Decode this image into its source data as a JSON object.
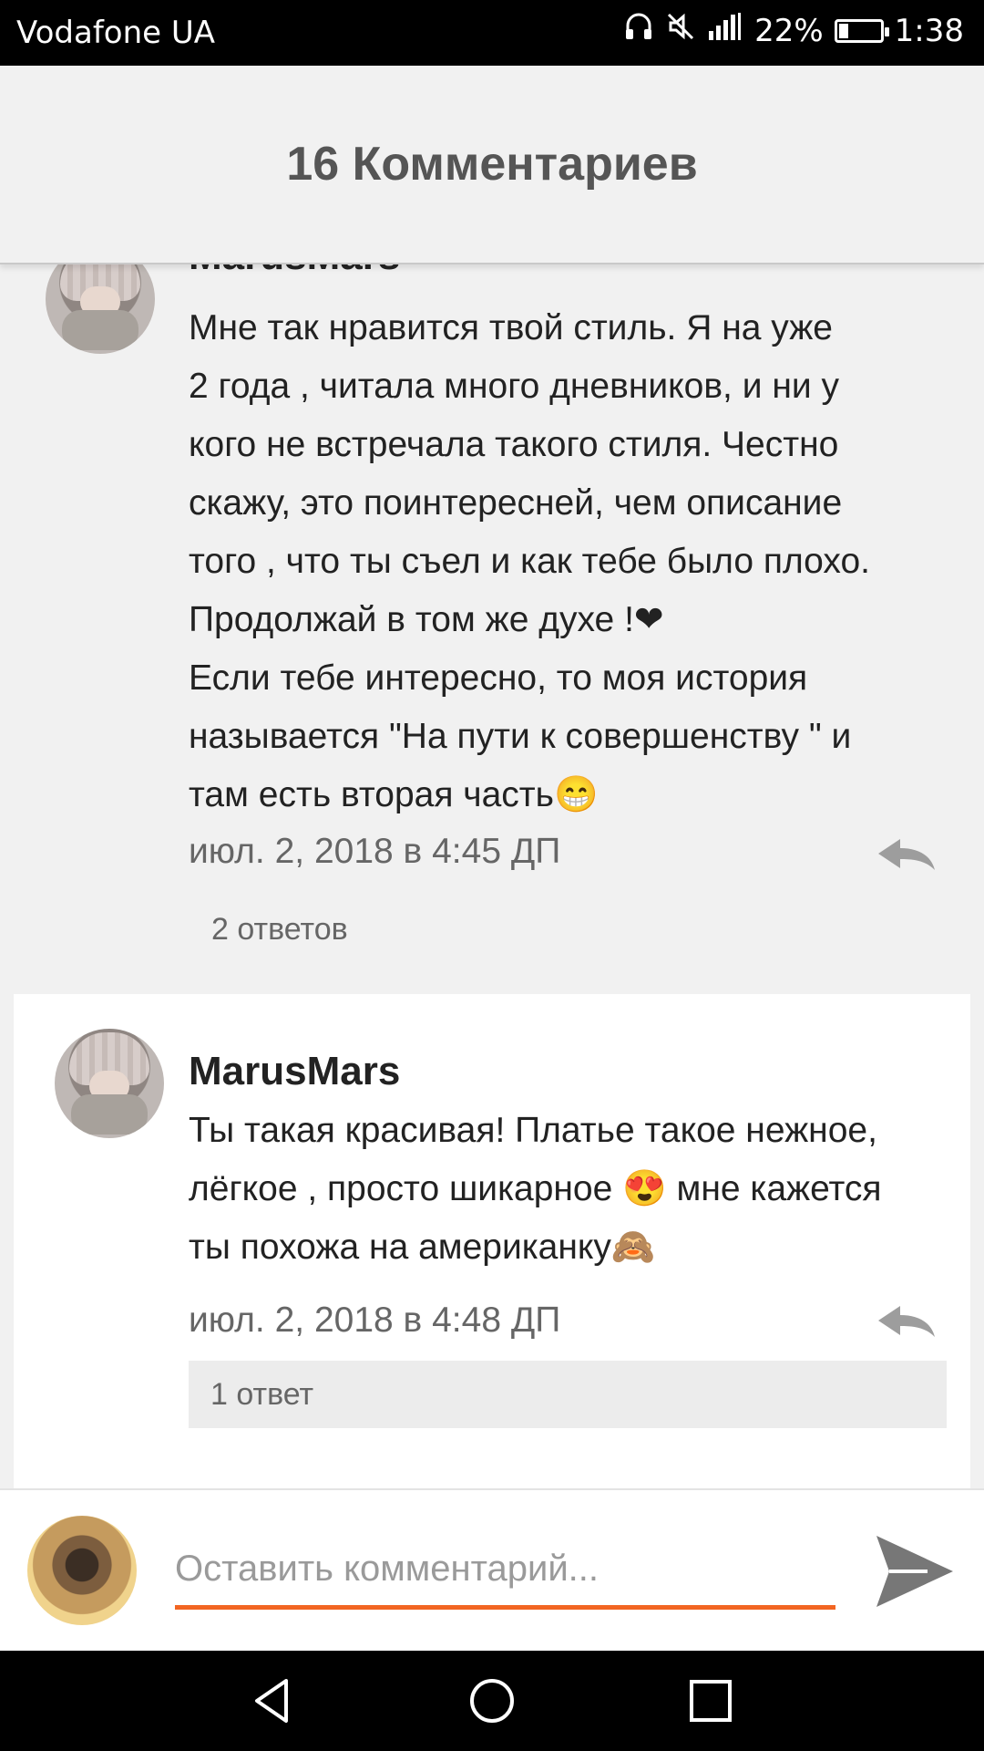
{
  "status_bar": {
    "carrier": "Vodafone UA",
    "battery_percent": "22%",
    "battery_level": 0.22,
    "time": "1:38",
    "icons": [
      "headphones-icon",
      "mute-icon",
      "signal-icon"
    ]
  },
  "header": {
    "title": "16 Комментариев"
  },
  "comments": [
    {
      "author": "MarusMars",
      "text": "Мне так нравится твой стиль.  Я на уже\n2 года , читала много дневников, и ни у\nкого не встречала такого стиля.  Честно\nскажу, это поинтересней, чем описание\nтого , что ты съел и как тебе было плохо.\nПродолжай в том же духе !❤\nЕсли тебе интересно, то моя история\nназывается \"На пути к совершенству \" и\nтам есть вторая часть😁",
      "date": "июл. 2, 2018 в 4:45 ДП",
      "replies": "2 ответов"
    },
    {
      "author": "MarusMars",
      "text": "Ты такая красивая! Платье такое нежное,\nлёгкое , просто шикарное 😍 мне кажется\nты похожа на американку🙈",
      "date": "июл. 2, 2018 в 4:48 ДП",
      "replies": "1 ответ"
    }
  ],
  "composer": {
    "placeholder": "Оставить комментарий..."
  },
  "colors": {
    "accent": "#f26522",
    "background": "#f1f1f1"
  }
}
